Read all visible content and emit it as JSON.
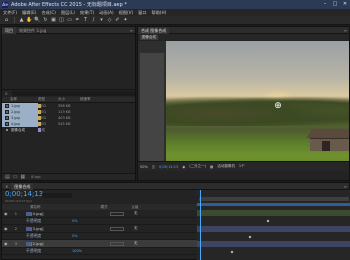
{
  "window": {
    "app_icon": "Ae",
    "title": "Adobe After Effects CC 2015 - 无标题项目.aep *",
    "controls": [
      "–",
      "□",
      "✕"
    ]
  },
  "menu": [
    "文件(F)",
    "编辑(E)",
    "合成(C)",
    "图层(L)",
    "效果(T)",
    "动画(A)",
    "视图(V)",
    "窗口",
    "帮助(H)"
  ],
  "toolbar": {
    "tools": [
      {
        "icon": "home-icon",
        "glyph": "⌂"
      },
      {
        "icon": "selection-icon",
        "glyph": "▲"
      },
      {
        "icon": "hand-icon",
        "glyph": "✋"
      },
      {
        "icon": "zoom-icon",
        "glyph": "🔍"
      },
      {
        "icon": "rotate-icon",
        "glyph": "↻"
      },
      {
        "icon": "camera-icon",
        "glyph": "▣"
      },
      {
        "icon": "pan-icon",
        "glyph": "◫"
      },
      {
        "icon": "rect-icon",
        "glyph": "▭"
      },
      {
        "icon": "pen-icon",
        "glyph": "✒"
      },
      {
        "icon": "text-icon",
        "glyph": "T"
      },
      {
        "icon": "brush-icon",
        "glyph": "/"
      },
      {
        "icon": "stamp-icon",
        "glyph": "▾"
      },
      {
        "icon": "eraser-icon",
        "glyph": "◇"
      },
      {
        "icon": "roto-icon",
        "glyph": "✐"
      },
      {
        "icon": "puppet-icon",
        "glyph": "✦"
      }
    ]
  },
  "project_panel": {
    "tabs": [
      "项目",
      "效果控件 3.jpg"
    ],
    "search_placeholder": "",
    "columns": {
      "name": "名称",
      "type": "类型",
      "size": "大小",
      "rate": "帧速率"
    },
    "rows": [
      {
        "name": "1.jpg",
        "type": "JPEG",
        "size": "398 KB",
        "selected": true
      },
      {
        "name": "2.jpg",
        "type": "JPEG",
        "size": "113 KB",
        "selected": true
      },
      {
        "name": "3.jpg",
        "type": "JPEG",
        "size": "403 KB",
        "selected": true
      },
      {
        "name": "4.jpg",
        "type": "JPEG",
        "size": "545 KB",
        "selected": true
      },
      {
        "name": "图像合成",
        "type": "合成",
        "size": "",
        "selected": false
      }
    ],
    "footer_bpc": "8 bpc"
  },
  "comp_panel": {
    "tabs": [
      "合成 图像合成"
    ],
    "chip": "图像合成",
    "viewer_bar": {
      "zoom": "50%",
      "timecode": "0;00;14;13",
      "resolution": "(二分之一)",
      "camera": "活动摄像机",
      "views": "1个"
    }
  },
  "timeline_panel": {
    "tabs": [
      "图像合成"
    ],
    "timecode": "0;00;14;13",
    "fps": "00433 (29.97 fps)",
    "header": {
      "source": "源名称",
      "mode": "模式",
      "parent": "父级"
    },
    "layers": [
      {
        "num": "1",
        "name": "[4.jpg]",
        "kind": "layer",
        "none": "无"
      },
      {
        "num": "",
        "name": "不透明度",
        "kind": "sub",
        "value": "0%"
      },
      {
        "num": "2",
        "name": "[3.jpg]",
        "kind": "layer",
        "none": "无"
      },
      {
        "num": "",
        "name": "不透明度",
        "kind": "sub",
        "value": "0%"
      },
      {
        "num": "3",
        "name": "[2.jpg]",
        "kind": "layer",
        "none": "无",
        "selected": true
      },
      {
        "num": "",
        "name": "不透明度",
        "kind": "sub",
        "value": "100%"
      }
    ]
  },
  "accent": "#4aa8ff"
}
